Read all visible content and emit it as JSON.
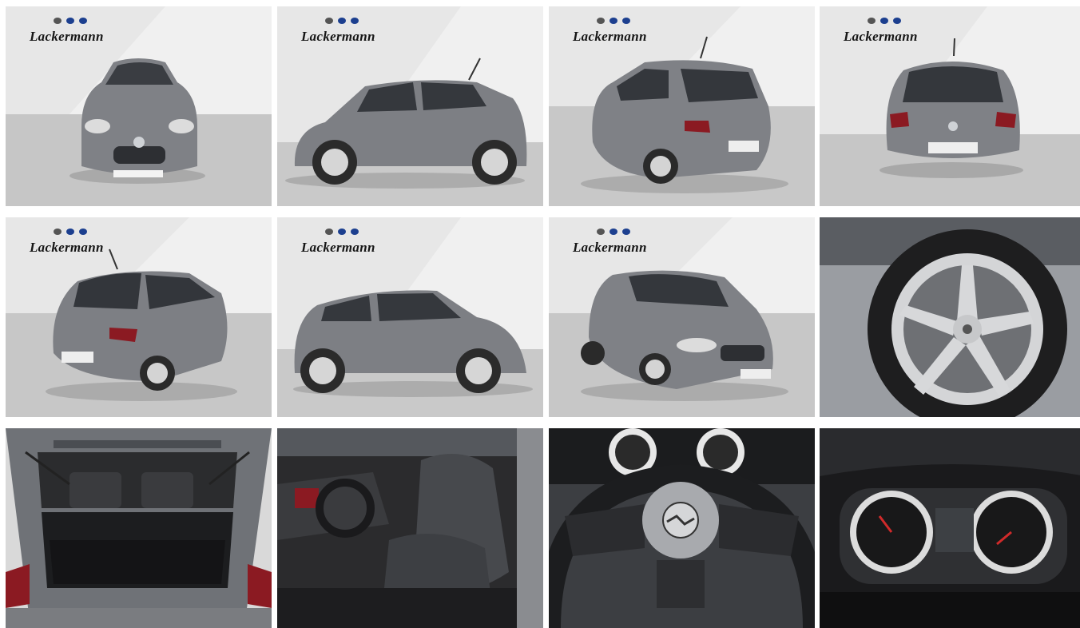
{
  "brand": {
    "name": "Lackermann",
    "icon": "dealer-logo-icon"
  },
  "gallery": {
    "tiles": [
      {
        "view": "front",
        "brand": true
      },
      {
        "view": "side-left",
        "brand": true
      },
      {
        "view": "rear-three-quarter-left",
        "brand": true
      },
      {
        "view": "rear",
        "brand": true
      },
      {
        "view": "rear-three-quarter-right",
        "brand": true
      },
      {
        "view": "side-right",
        "brand": true
      },
      {
        "view": "front-three-quarter",
        "brand": true
      },
      {
        "view": "wheel",
        "brand": false
      },
      {
        "view": "trunk",
        "brand": false
      },
      {
        "view": "interior-seats",
        "brand": false
      },
      {
        "view": "steering-wheel",
        "brand": false
      },
      {
        "view": "instrument-cluster",
        "brand": false
      }
    ]
  },
  "colors": {
    "car": "#7d7f84",
    "floor": "#c9c9c9",
    "backdrop": "#f1f1f1",
    "interior": "#2b2b2d"
  }
}
